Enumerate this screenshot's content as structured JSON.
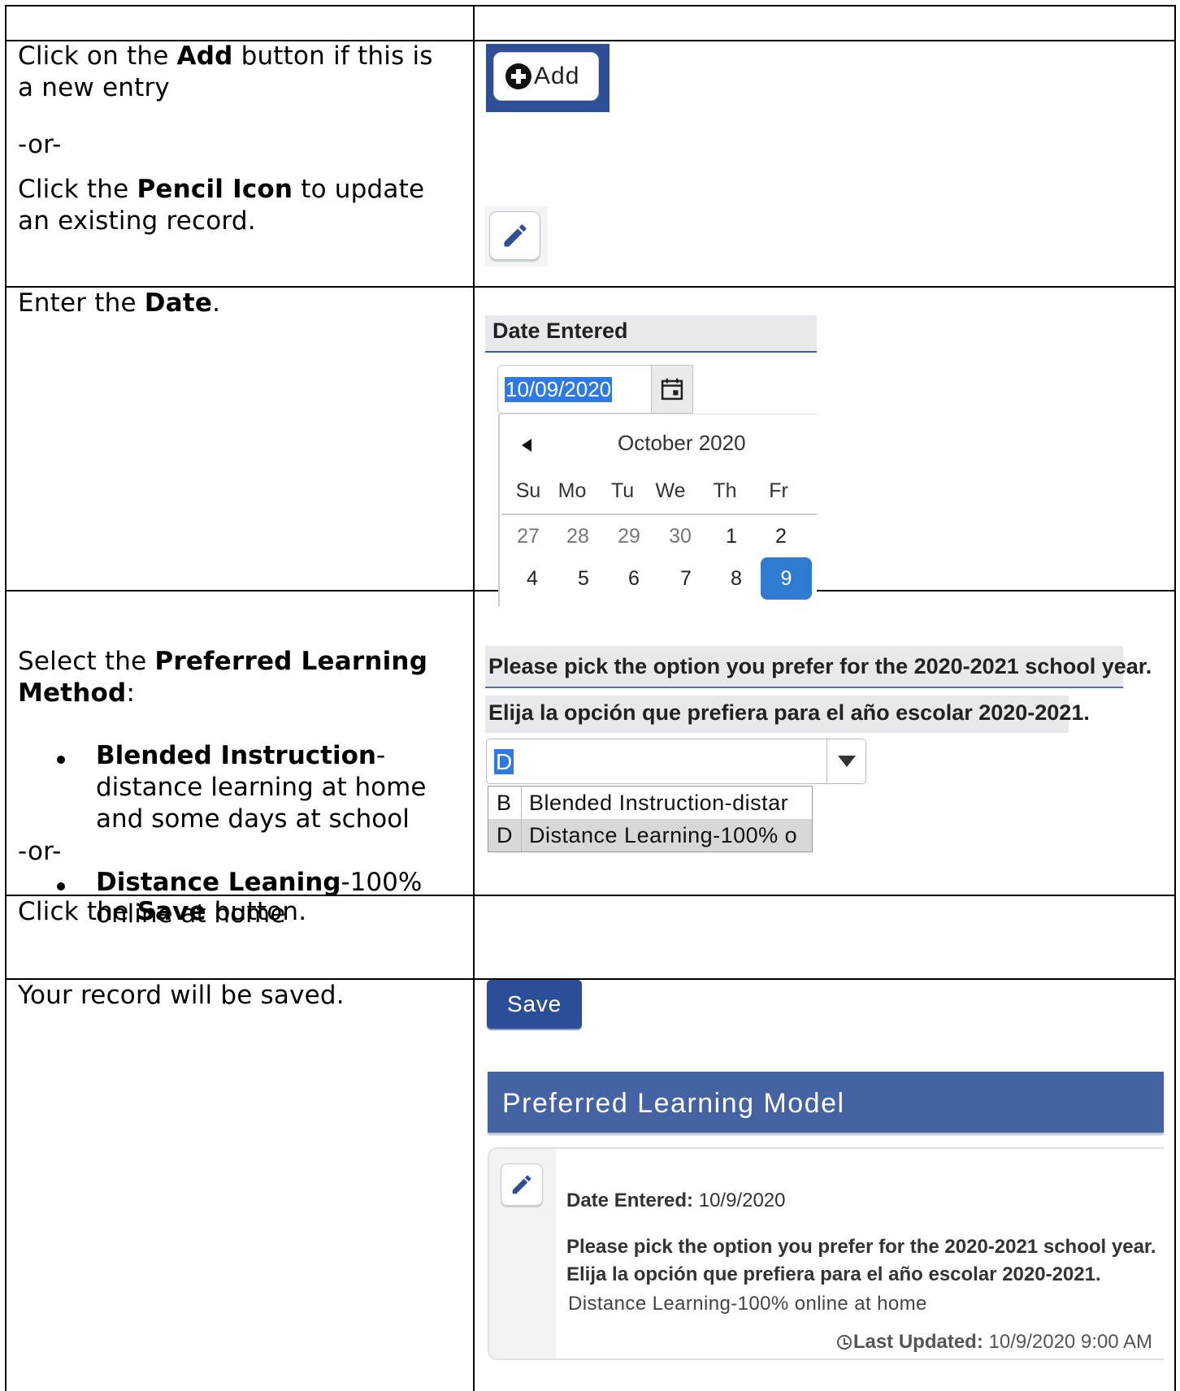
{
  "rows": {
    "add": {
      "line1_pre": "Click on the ",
      "line1_bold": "Add",
      "line1_post": " button if this is",
      "line2": "a new entry",
      "or": "-or-",
      "line3_pre": "Click the ",
      "line3_bold": "Pencil Icon",
      "line3_post": " to update",
      "line4": "an existing record."
    },
    "date": {
      "pre": "Enter the ",
      "bold": "Date",
      "post": "."
    },
    "method": {
      "pre": "Select the ",
      "bold1": "Preferred Learning",
      "bold2": "Method",
      "post": ":",
      "bullet1_bold": "Blended Instruction",
      "bullet1_rest1": "-",
      "bullet1_line2": "distance learning at home",
      "bullet1_line3": "and some days at school",
      "or": "-or-",
      "bullet2_bold": "Distance Leaning",
      "bullet2_rest1": "-100%",
      "bullet2_line2": "online at home"
    },
    "save": {
      "pre": "Click the ",
      "bold": "Save",
      "post": " button."
    },
    "saved": {
      "text": "Your record will be saved."
    }
  },
  "widgets": {
    "add_button_label": "Add",
    "date_header": "Date Entered",
    "date_value": "10/09/2020",
    "calendar": {
      "month": "October 2020",
      "weekdays": [
        "Su",
        "Mo",
        "Tu",
        "We",
        "Th",
        "Fr"
      ],
      "week1": [
        "27",
        "28",
        "29",
        "30",
        "1",
        "2"
      ],
      "week2": [
        "4",
        "5",
        "6",
        "7",
        "8",
        "9"
      ],
      "selected_day": "9"
    },
    "question_en": "Please pick the option you prefer for the 2020-2021 school year.",
    "question_es": "Elija la opción que prefiera para el año escolar 2020-2021.",
    "select_value": "D",
    "options": [
      {
        "key": "B",
        "label": "Blended Instruction-distar"
      },
      {
        "key": "D",
        "label": "Distance Learning-100% o"
      }
    ],
    "save_label": "Save",
    "panel": {
      "title": "Preferred Learning Model",
      "date_label": "Date Entered:",
      "date_value": " 10/9/2020",
      "question_en": "Please pick the option you prefer for the 2020-2021 school year.",
      "question_es": "Elija la opción que prefiera para el año escolar 2020-2021.",
      "answer": "Distance Learning-100% online at home",
      "updated_label": "Last Updated:",
      "updated_value": " 10/9/2020 9:00 AM"
    }
  },
  "colors": {
    "brand_blue": "#2b4f97",
    "panel_header": "#4563a3",
    "selection_blue": "#2f7ae2"
  }
}
